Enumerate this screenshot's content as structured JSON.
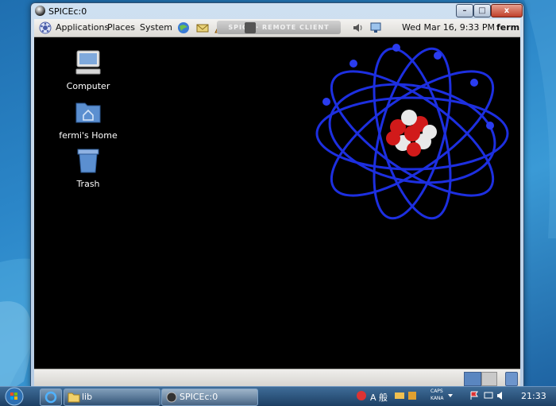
{
  "window": {
    "title": "SPICEc:0",
    "minimize_glyph": "–",
    "maximize_glyph": "□",
    "close_glyph": "x"
  },
  "top_panel": {
    "menus": [
      "Applications",
      "Places",
      "System"
    ],
    "spice_banner": "SPICE · REMOTE CLIENT",
    "clock": "Wed Mar 16,  9:33 PM",
    "user": "fermi",
    "icons": [
      "gnome-foot-icon",
      "web-browser-icon",
      "mail-client-icon",
      "app-icon",
      "spice-client-icon",
      "volume-icon",
      "network-icon"
    ]
  },
  "desktop": {
    "icons": [
      {
        "label": "Computer",
        "icon": "computer-icon"
      },
      {
        "label": "fermi's Home",
        "icon": "home-folder-icon"
      },
      {
        "label": "Trash",
        "icon": "trash-icon"
      }
    ],
    "wallpaper": "atom-nucleus-wallpaper"
  },
  "bottom_panel": {
    "workspaces": 2,
    "active_workspace": 1
  },
  "taskbar": {
    "buttons": [
      {
        "label": "",
        "icon": "internet-explorer-icon"
      },
      {
        "label": "lib",
        "icon": "folder-icon"
      },
      {
        "label": "SPICEc:0",
        "icon": "spice-icon"
      }
    ],
    "tray_text": {
      "caps": "CAPS",
      "kana": "KANA",
      "ime": "A 般"
    },
    "clock": "21:33"
  },
  "colors": {
    "orbit_blue": "#1d2fe0",
    "nucleus_red": "#d11a1a",
    "nucleus_white": "#e8e8e8",
    "guest_bg": "#000000"
  }
}
